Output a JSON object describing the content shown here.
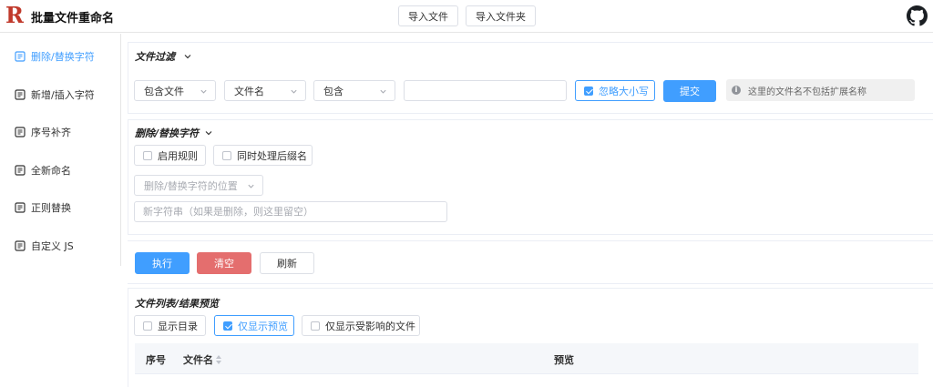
{
  "app": {
    "logo_letter": "R",
    "title": "批量文件重命名"
  },
  "header": {
    "import_file": "导入文件",
    "import_folder": "导入文件夹"
  },
  "sidebar": {
    "items": [
      {
        "label": "删除/替换字符",
        "active": true
      },
      {
        "label": "新增/插入字符"
      },
      {
        "label": "序号补齐"
      },
      {
        "label": "全新命名"
      },
      {
        "label": "正则替换"
      },
      {
        "label": "自定义 JS"
      }
    ]
  },
  "filter": {
    "title": "文件过滤",
    "mode": "包含文件",
    "target": "文件名",
    "match": "包含",
    "text_value": "",
    "ignore_case": "忽略大小写",
    "submit": "提交",
    "hint": "这里的文件名不包括扩展名称"
  },
  "replace": {
    "title": "删除/替换字符",
    "enable_rule": "启用规则",
    "process_suffix": "同时处理后缀名",
    "position_placeholder": "删除/替换字符的位置",
    "new_string_placeholder": "新字符串（如果是删除，则这里留空）"
  },
  "actions": {
    "execute": "执行",
    "clear": "清空",
    "refresh": "刷新"
  },
  "filelist": {
    "title": "文件列表/结果预览",
    "show_dirs": "显示目录",
    "preview_only": "仅显示预览",
    "affected_only": "仅显示受影响的文件",
    "columns": {
      "index": "序号",
      "name": "文件名",
      "preview": "预览"
    }
  },
  "colors": {
    "primary": "#409eff",
    "danger": "#e46e6e",
    "logo": "#c0392b"
  }
}
